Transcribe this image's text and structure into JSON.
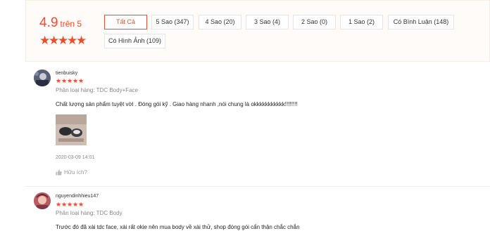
{
  "summary": {
    "score": "4.9",
    "score_suffix": "trên 5",
    "stars": 5,
    "star_color": "#ee4d2d"
  },
  "filters": [
    {
      "label": "Tất Cả",
      "active": true
    },
    {
      "label": "5 Sao (347)",
      "active": false
    },
    {
      "label": "4 Sao (20)",
      "active": false
    },
    {
      "label": "3 Sao (4)",
      "active": false
    },
    {
      "label": "2 Sao (0)",
      "active": false
    },
    {
      "label": "1 Sao (2)",
      "active": false
    },
    {
      "label": "Có Bình Luận (148)",
      "active": false
    },
    {
      "label": "Có Hình Ảnh (109)",
      "active": false
    }
  ],
  "reviews": [
    {
      "username": "tienbuisky",
      "stars": 5,
      "variant": "Phân loại hàng: TDC Body+Face",
      "content": "Chất lượng sản phẩm tuyệt vời . Đóng gói kỹ . Giao hàng nhanh ,nói chung là okkkkkkkkkkk!!!!!!!!",
      "timestamp": "2020-03-09 14:01",
      "helpful_label": "Hữu ích?"
    },
    {
      "username": "nguyendinhhieu147",
      "stars": 5,
      "variant": "Phân loại hàng: TDC Body",
      "content": "Trước đó đã xài tdc face, xài rất okie nên mua body về xài thử, shop đóng gói cẩn thận chắc chắn"
    }
  ],
  "icons": {
    "star": "star-icon",
    "helpful": "thumbs-up-icon"
  }
}
